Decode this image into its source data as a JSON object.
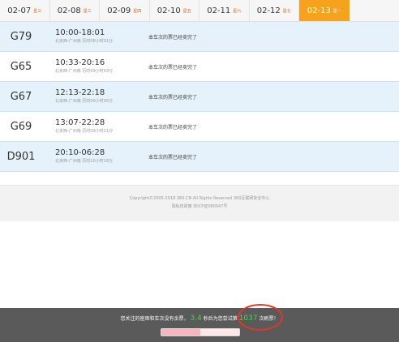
{
  "dates": [
    {
      "date": "02-07",
      "weekday": "星三",
      "active": false
    },
    {
      "date": "02-08",
      "weekday": "星三",
      "active": false
    },
    {
      "date": "02-09",
      "weekday": "星四",
      "active": false
    },
    {
      "date": "02-10",
      "weekday": "星五",
      "active": false
    },
    {
      "date": "02-11",
      "weekday": "星六",
      "active": false
    },
    {
      "date": "02-12",
      "weekday": "星七",
      "active": false
    },
    {
      "date": "02-13",
      "weekday": "星一",
      "active": true
    }
  ],
  "trains": [
    {
      "number": "G79",
      "time": "10:00-18:01",
      "route": "北京西-广州南 历时08小时01分",
      "status": "本车次的票已经卖完了"
    },
    {
      "number": "G65",
      "time": "10:33-20:16",
      "route": "北京西-广州南 历时09小时43分",
      "status": "本车次的票已经卖完了"
    },
    {
      "number": "G67",
      "time": "12:13-22:18",
      "route": "北京西-广州南 历时09小时05分",
      "status": "本车次的票已经卖完了"
    },
    {
      "number": "G69",
      "time": "13:07-22:28",
      "route": "北京西-广州南 历时09小时21分",
      "status": "本车次的票已经卖完了"
    },
    {
      "number": "D901",
      "time": "20:10-06:28",
      "route": "北京西-广州南 历时10小时18分",
      "status": "本车次的票已经卖完了"
    }
  ],
  "footer": {
    "copyright": "Copyright©2005-2018 360.CN All Rights Reserved 360互联网安全中心",
    "links": "隐私权政策 京ICP证080047号"
  },
  "notice": {
    "prefix": "您关注的座席和车次没有余票，",
    "seconds": "3.4",
    "middle": "秒后为您尝试第",
    "count": "1037",
    "suffix": "次刷票！",
    "progress": 0.5
  },
  "colors": {
    "accent": "#f7a21d",
    "row_alt": "#e6f2fb",
    "highlight": "#e0372a",
    "count_green": "#52d04a"
  }
}
